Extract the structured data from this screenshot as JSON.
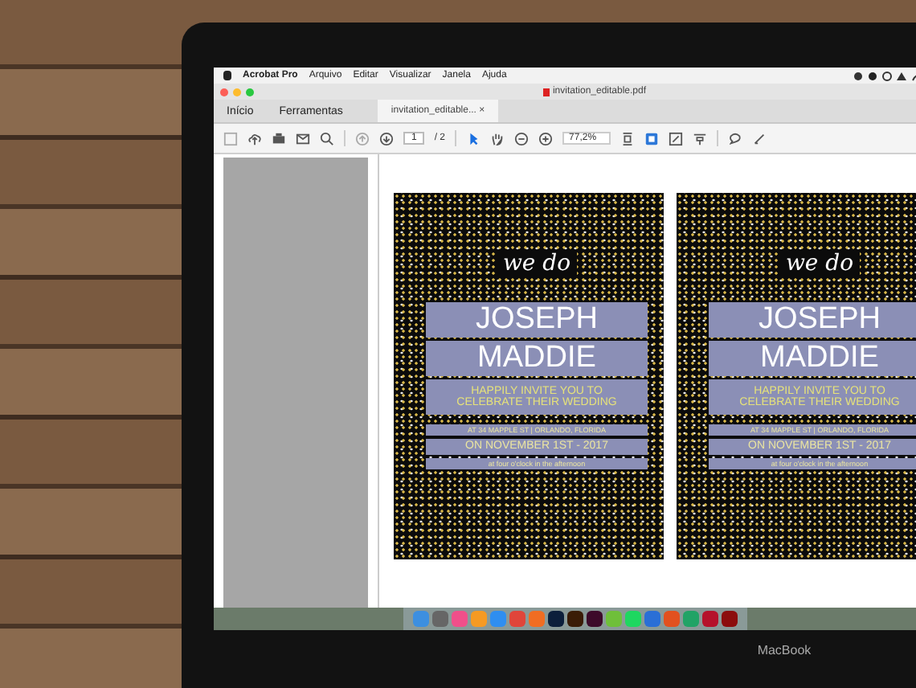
{
  "menu_bar": {
    "app": "Acrobat Pro",
    "items": [
      "Arquivo",
      "Editar",
      "Visualizar",
      "Janela",
      "Ajuda"
    ]
  },
  "window": {
    "title": "invitation_editable.pdf"
  },
  "tabs": [
    {
      "label": "Início",
      "selected": false,
      "kind": "nav"
    },
    {
      "label": "Ferramentas",
      "selected": false,
      "kind": "nav"
    },
    {
      "label": "invitation_editable...",
      "selected": true,
      "kind": "document",
      "close": "×"
    }
  ],
  "toolbar": {
    "page": "1",
    "page_count": "/ 2",
    "zoom": "77,2%"
  },
  "invitations": [
    {
      "script": "we do",
      "names": [
        "JOSEPH",
        "MADDIE"
      ],
      "invite": [
        "HAPPILY INVITE YOU TO",
        "CELEBRATE THEIR WEDDING"
      ],
      "address": "AT 34 MAPPLE ST | ORLANDO, FLORIDA",
      "date": "ON NOVEMBER 1ST - 2017",
      "time": "at four o'clock in the afternoon"
    },
    {
      "script": "we do",
      "names": [
        "JOSEPH",
        "MADDIE"
      ],
      "invite": [
        "HAPPILY INVITE YOU TO",
        "CELEBRATE THEIR WEDDING"
      ],
      "address": "AT 34 MAPPLE ST | ORLANDO, FLORIDA",
      "date": "ON NOVEMBER 1ST - 2017",
      "time": "at four o'clock in the afternoon"
    }
  ],
  "laptop_label": "MacBook"
}
